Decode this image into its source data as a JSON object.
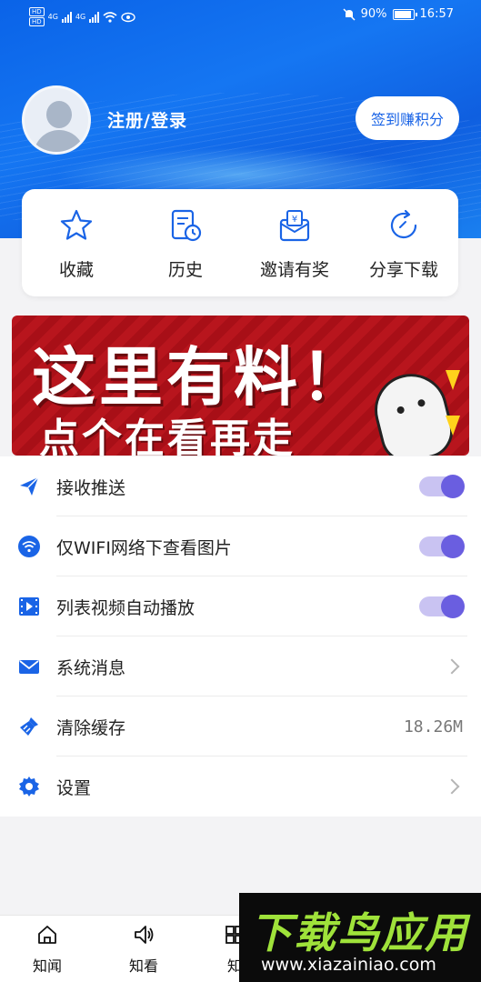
{
  "status_bar": {
    "battery": "90%",
    "time": "16:57",
    "sim1": "HD",
    "sim2": "HD",
    "net1": "4G",
    "net2": "4G"
  },
  "profile": {
    "login_label": "注册/登录",
    "signin_button": "签到赚积分"
  },
  "quick_actions": [
    {
      "label": "收藏",
      "icon": "star-icon"
    },
    {
      "label": "历史",
      "icon": "history-icon"
    },
    {
      "label": "邀请有奖",
      "icon": "red-envelope-icon"
    },
    {
      "label": "分享下载",
      "icon": "share-refresh-icon"
    }
  ],
  "banner": {
    "line1": "这里有料！",
    "line2": "点个在看再走"
  },
  "settings": [
    {
      "label": "接收推送",
      "icon": "paper-plane-icon",
      "control": "toggle",
      "on": true
    },
    {
      "label": "仅WIFI网络下查看图片",
      "icon": "wifi-icon",
      "control": "toggle",
      "on": true
    },
    {
      "label": "列表视频自动播放",
      "icon": "video-icon",
      "control": "toggle",
      "on": true
    },
    {
      "label": "系统消息",
      "icon": "mail-icon",
      "control": "chevron"
    },
    {
      "label": "清除缓存",
      "icon": "broom-icon",
      "control": "value",
      "value": "18.26M"
    },
    {
      "label": "设置",
      "icon": "gear-icon",
      "control": "chevron"
    }
  ],
  "tabbar": [
    {
      "label": "知闻",
      "icon": "home-icon"
    },
    {
      "label": "知看",
      "icon": "speaker-icon"
    },
    {
      "label": "知",
      "icon": "grid-icon"
    }
  ],
  "watermark": {
    "title": "下载鸟应用",
    "url": "www.xiazainiao.com"
  },
  "colors": {
    "primary": "#1a64e6",
    "toggle_on": "#6a5ee0",
    "banner_red": "#b8151d"
  }
}
